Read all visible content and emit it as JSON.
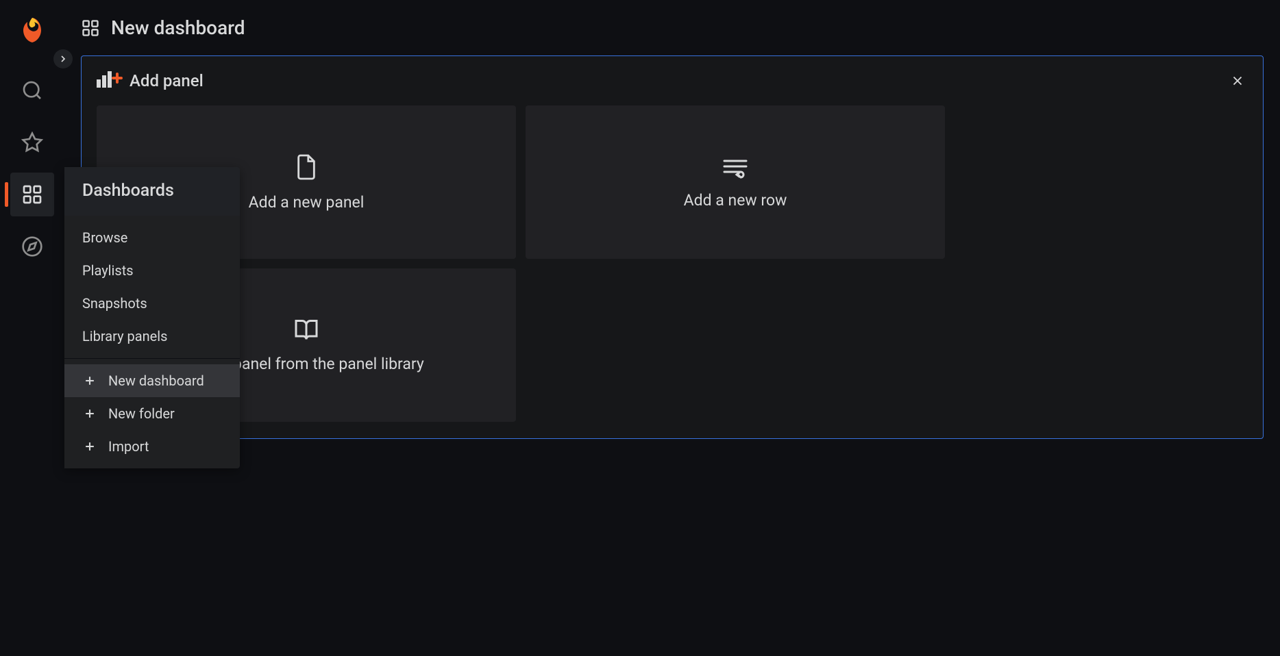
{
  "page": {
    "title": "New dashboard"
  },
  "addPanel": {
    "title": "Add panel",
    "options": [
      {
        "label": "Add a new panel",
        "icon": "file"
      },
      {
        "label": "Add a new row",
        "icon": "row"
      },
      {
        "label": "Add a panel from the panel library",
        "icon": "book"
      }
    ]
  },
  "flyout": {
    "title": "Dashboards",
    "items": [
      {
        "label": "Browse"
      },
      {
        "label": "Playlists"
      },
      {
        "label": "Snapshots"
      },
      {
        "label": "Library panels"
      }
    ],
    "actions": [
      {
        "label": "New dashboard",
        "highlighted": true
      },
      {
        "label": "New folder",
        "highlighted": false
      },
      {
        "label": "Import",
        "highlighted": false
      }
    ]
  },
  "sidebar": {
    "items": [
      {
        "name": "search"
      },
      {
        "name": "starred"
      },
      {
        "name": "dashboards",
        "active": true
      },
      {
        "name": "explore"
      }
    ]
  }
}
